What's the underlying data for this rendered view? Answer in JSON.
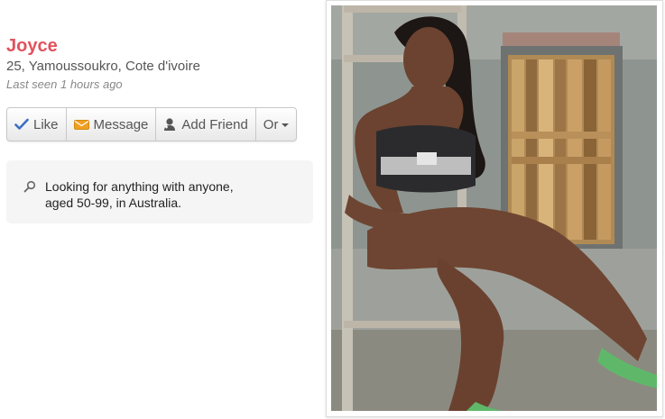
{
  "profile": {
    "name": "Joyce",
    "details": "25, Yamoussoukro, Cote d'ivoire",
    "last_seen": "Last seen 1 hours ago"
  },
  "actions": {
    "like_label": "Like",
    "message_label": "Message",
    "add_friend_label": "Add Friend",
    "more_label": "Or"
  },
  "looking_for": {
    "icon": "search-icon",
    "line1": "Looking for anything with anyone,",
    "line2": "aged 50-99, in Australia."
  },
  "photo": {
    "subject": "profile-photo"
  },
  "colors": {
    "name": "#e0535e",
    "like_icon": "#3b6fc4",
    "message_icon": "#f0a020"
  }
}
